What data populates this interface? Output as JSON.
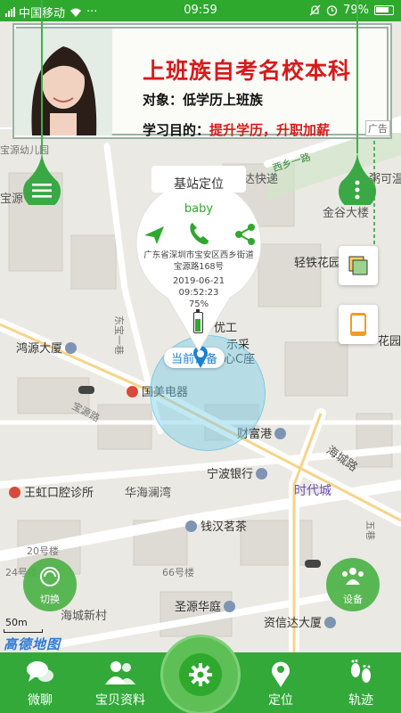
{
  "status_bar": {
    "carrier": "中国移动",
    "dots": "···",
    "time": "09:59",
    "battery": "79%"
  },
  "banner": {
    "title": "上班族自考名校本科",
    "target": "对象：低学历上班族",
    "goal_prefix": "学习目的：",
    "goal_highlight": "提升学历，升职加薪",
    "ad_label": "广告"
  },
  "popup": {
    "title": "基站定位",
    "device_name": "baby",
    "address": "广东省深圳市宝安区西乡街道宝源路168号",
    "date": "2019-06-21",
    "time": "09:52:23",
    "battery_percent": "75%",
    "battery_level": 0.75
  },
  "map": {
    "current_device_label": "当前设备",
    "scale": "50m",
    "logo": "高德地图",
    "pois": {
      "kindergarten": "宝源幼儿园",
      "baoyuan": "宝源",
      "express": "韵达快递",
      "yilu": "西乡一路",
      "kekou": "粥可温",
      "jingu": "金谷大楼",
      "qingtie": "轻铁花园",
      "huayuan": "花园",
      "dongbao": "东宝一巷",
      "hongyuan": "鸿源大厦",
      "guomei": "国美电器",
      "jiaoqiao": "宝源路",
      "zhongxin": "中心C座",
      "youchuang": "多优工",
      "biaocai": "示采",
      "caifu": "财富港",
      "ningbo": "宁波银行",
      "haicheng": "海城路",
      "shidai": "时代城",
      "wanghong": "王虹口腔诊所",
      "huahai": "华海澜湾",
      "qianhan": "钱汉茗茶",
      "hao20": "20号楼",
      "hao24": "24号楼",
      "hao66": "66号楼",
      "shengyuan": "圣源华庭",
      "xinda": "资信达大厦",
      "haicheng_village": "海城新村",
      "wuxiang": "五巷"
    }
  },
  "buttons": {
    "switch": "切换",
    "device": "设备"
  },
  "tabs": [
    {
      "label": "微聊",
      "icon": "chat-bubbles-icon"
    },
    {
      "label": "宝贝资料",
      "icon": "profile-icon"
    },
    {
      "label": "",
      "icon": "settings-gear-icon"
    },
    {
      "label": "定位",
      "icon": "location-pin-icon"
    },
    {
      "label": "轨迹",
      "icon": "footprints-icon"
    }
  ],
  "colors": {
    "brand_green": "#2fa82e",
    "banner_red": "#d51b1b",
    "accuracy_blue": "#76cde8"
  }
}
